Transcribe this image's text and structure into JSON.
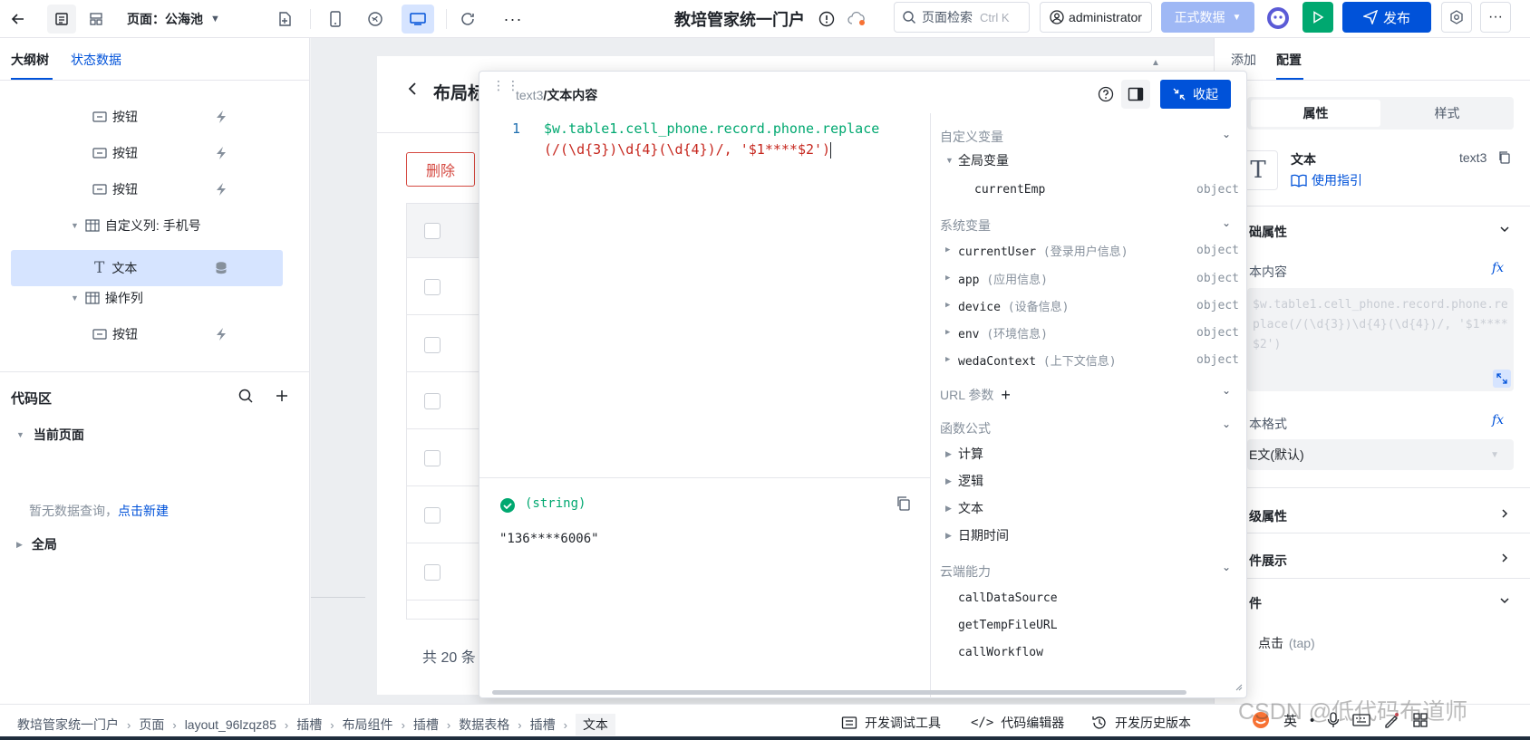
{
  "topbar": {
    "page_label": "页面：公海池",
    "app_title": "教培管家统一门户",
    "search_placeholder": "页面检索",
    "search_shortcut": "Ctrl K",
    "user": "administrator",
    "env": "正式数据",
    "publish": "发布"
  },
  "left": {
    "tabs": [
      "大纲树",
      "状态数据"
    ],
    "tree": {
      "btn1": "按钮",
      "btn2": "按钮",
      "btn3": "按钮",
      "col_phone": "自定义列: 手机号",
      "text": "文本",
      "col_ops": "操作列",
      "btn4": "按钮"
    },
    "code": {
      "title": "代码区",
      "current_page": "当前页面",
      "empty_text": "暂无数据查询，",
      "create_link": "点击新建",
      "global": "全局"
    }
  },
  "canvas": {
    "page_title": "布局标",
    "delete_btn": "删除",
    "footer_total": "共 20 条"
  },
  "popup": {
    "breadcrumb_a": "text3",
    "breadcrumb_b": "/文本内容",
    "collapse": "收起",
    "line_no": "1",
    "code_line1": "$w.table1.cell_phone.record.phone.replace",
    "code_line2": "(/(\\d{3})\\d{4}(\\d{4})/, '$1****$2')",
    "result_type": "(string)",
    "result_value": "\"136****6006\"",
    "vars": {
      "custom": "自定义变量",
      "global_vars": "全局变量",
      "currentEmp": "currentEmp",
      "system": "系统变量",
      "currentUser": "currentUser",
      "currentUser_desc": "(登录用户信息)",
      "app": "app",
      "app_desc": "(应用信息)",
      "device": "device",
      "device_desc": "(设备信息)",
      "env": "env",
      "env_desc": "(环境信息)",
      "wedaContext": "wedaContext",
      "wedaContext_desc": "(上下文信息)",
      "url_params": "URL 参数",
      "functions": "函数公式",
      "calc": "计算",
      "logic": "逻辑",
      "text": "文本",
      "datetime": "日期时间",
      "cloud": "云端能力",
      "callDataSource": "callDataSource",
      "getTempFileURL": "getTempFileURL",
      "callWorkflow": "callWorkflow",
      "type_object": "object"
    }
  },
  "right": {
    "tabs": [
      "添加",
      "配置"
    ],
    "subtabs": [
      "属性",
      "样式"
    ],
    "component_name": "文本",
    "component_id": "text3",
    "guide": "使用指引",
    "basic_props": "础属性",
    "text_content_label": "本内容",
    "text_content_value": "$w.table1.cell_phone.record.phone.replace(/(\\d{3})\\d{4}(\\d{4})/, '$1****$2')",
    "text_format_label": "本格式",
    "text_format_value": "E文(默认)",
    "advanced": "级属性",
    "display": "件展示",
    "events": "件",
    "event_click": "点击",
    "event_click_code": "(tap)"
  },
  "bottom": {
    "crumbs": [
      "教培管家统一门户",
      "页面",
      "layout_96lzqz85",
      "插槽",
      "布局组件",
      "插槽",
      "数据表格",
      "插槽",
      "文本"
    ],
    "dev_tools": "开发调试工具",
    "code_editor": "代码编辑器",
    "history": "开发历史版本",
    "watermark": "CSDN @低代码布道师"
  },
  "colors": {
    "primary": "#0052d9",
    "green": "#00a870",
    "danger": "#d54941"
  }
}
